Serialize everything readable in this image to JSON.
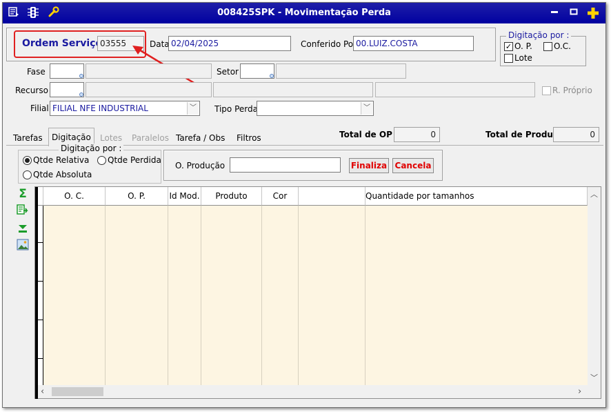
{
  "window": {
    "title": "008425SPK - Movimentação Perda"
  },
  "header": {
    "ordem_label": "Ordem Serviço",
    "ordem_value": "03555",
    "data_label": "Data",
    "data_value": "02/04/2025",
    "conferido_label": "Conferido Por",
    "conferido_value": "00.LUIZ.COSTA"
  },
  "digitacao_box": {
    "legend": "Digitação por :",
    "op_label": "O. P.",
    "oc_label": "O.C.",
    "lote_label": "Lote",
    "op_checked": true
  },
  "form": {
    "fase_label": "Fase",
    "setor_label": "Setor",
    "recurso_label": "Recurso",
    "rproprio_label": "R. Próprio",
    "filial_label": "Filial",
    "filial_value": "FILIAL NFE INDUSTRIAL",
    "tipo_perda_label": "Tipo Perda",
    "tipo_perda_value": ""
  },
  "tabs": [
    {
      "label": "Tarefas"
    },
    {
      "label": "Digitação"
    },
    {
      "label": "Lotes"
    },
    {
      "label": "Paralelos"
    },
    {
      "label": "Tarefa / Obs"
    },
    {
      "label": "Filtros"
    }
  ],
  "totals": {
    "op_label": "Total de OP´s",
    "op_value": "0",
    "prod_label": "Total de Produtos",
    "prod_value": "0"
  },
  "digitacao_panel": {
    "legend": "Digitação por :",
    "qtde_relativa": "Qtde Relativa",
    "qtde_perdida": "Qtde Perdida",
    "qtde_absoluta": "Qtde Absoluta"
  },
  "producao": {
    "label": "O. Produção",
    "value": "",
    "finaliza": "Finaliza",
    "cancela": "Cancela"
  },
  "grid": {
    "columns": [
      "O. C.",
      "O. P.",
      "Id Mod.",
      "Produto",
      "Cor",
      "Quantidade por tamanhos"
    ]
  },
  "colors": {
    "title_bar": "#0000a0",
    "label_blue": "#1a1aa0",
    "button_red": "#e00000",
    "highlight_red": "#e02020",
    "grid_row": "#fdf5e2"
  }
}
